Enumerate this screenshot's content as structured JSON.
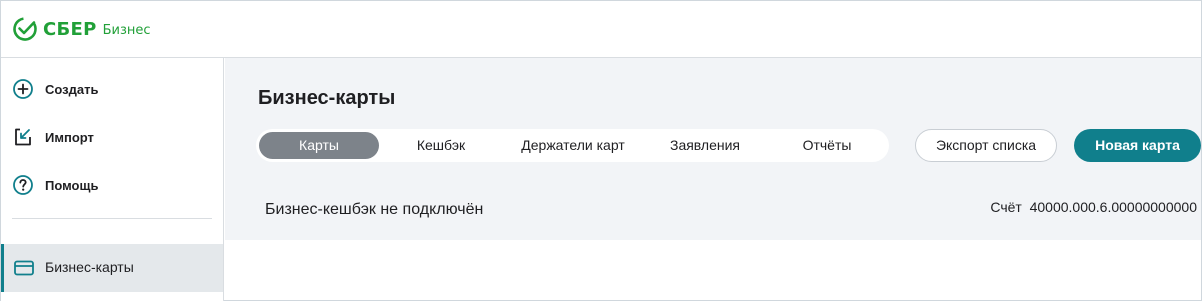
{
  "header": {
    "logo_word": "СБЕР",
    "logo_sub": "Бизнес",
    "brand_color": "#21a038"
  },
  "sidebar": {
    "items": [
      {
        "label": "Создать",
        "icon": "plus-circle-icon"
      },
      {
        "label": "Импорт",
        "icon": "import-icon"
      },
      {
        "label": "Помощь",
        "icon": "help-circle-icon"
      }
    ],
    "active_item": {
      "label": "Бизнес-карты",
      "icon": "card-icon"
    },
    "accent_color": "#107f8c"
  },
  "main": {
    "title": "Бизнес-карты",
    "tabs": [
      {
        "label": "Карты",
        "active": true
      },
      {
        "label": "Кешбэк",
        "active": false
      },
      {
        "label": "Держатели карт",
        "active": false
      },
      {
        "label": "Заявления",
        "active": false
      },
      {
        "label": "Отчёты",
        "active": false
      }
    ],
    "export_button": "Экспорт списка",
    "new_card_button": "Новая карта",
    "cashback_status": "Бизнес-кешбэк не подключён",
    "account_label": "Счёт",
    "account_number": "40000.000.6.00000000000"
  }
}
